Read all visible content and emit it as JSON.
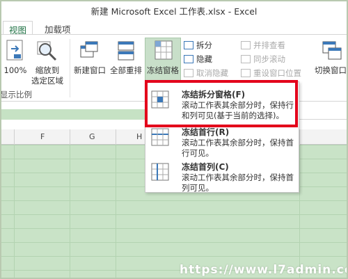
{
  "window": {
    "title": "新建 Microsoft Excel 工作表.xlsx - Excel"
  },
  "tabs": [
    {
      "label": "视图",
      "active": true
    },
    {
      "label": "加载项",
      "active": false
    }
  ],
  "ribbon": {
    "zoom_100_label": "100%",
    "zoom_selection_label_line1": "缩放到",
    "zoom_selection_label_line2": "选定区域",
    "new_window_label": "新建窗口",
    "arrange_all_label": "全部重排",
    "freeze_panes_label": "冻结窗格",
    "split_label": "拆分",
    "hide_label": "隐藏",
    "unhide_label": "取消隐藏",
    "view_side_by_side_label": "并排查看",
    "sync_scroll_label": "同步滚动",
    "reset_position_label": "重设窗口位置",
    "switch_windows_label": "切换窗口",
    "group_label": "显示比例"
  },
  "columns": [
    "F",
    "G",
    "H"
  ],
  "freeze_menu": [
    {
      "title": "冻结拆分窗格(F)",
      "desc": "滚动工作表其余部分时，保持行和列可见(基于当前的选择)。"
    },
    {
      "title": "冻结首行(R)",
      "desc": "滚动工作表其余部分时，保持首行可见。"
    },
    {
      "title": "冻结首列(C)",
      "desc": "滚动工作表其余部分时，保持首列可见。"
    }
  ],
  "watermark": "https://www.l7admin.cc",
  "colors": {
    "accent": "#217346",
    "highlight": "#e3001b",
    "sheet_green": "#c9e3c7"
  }
}
